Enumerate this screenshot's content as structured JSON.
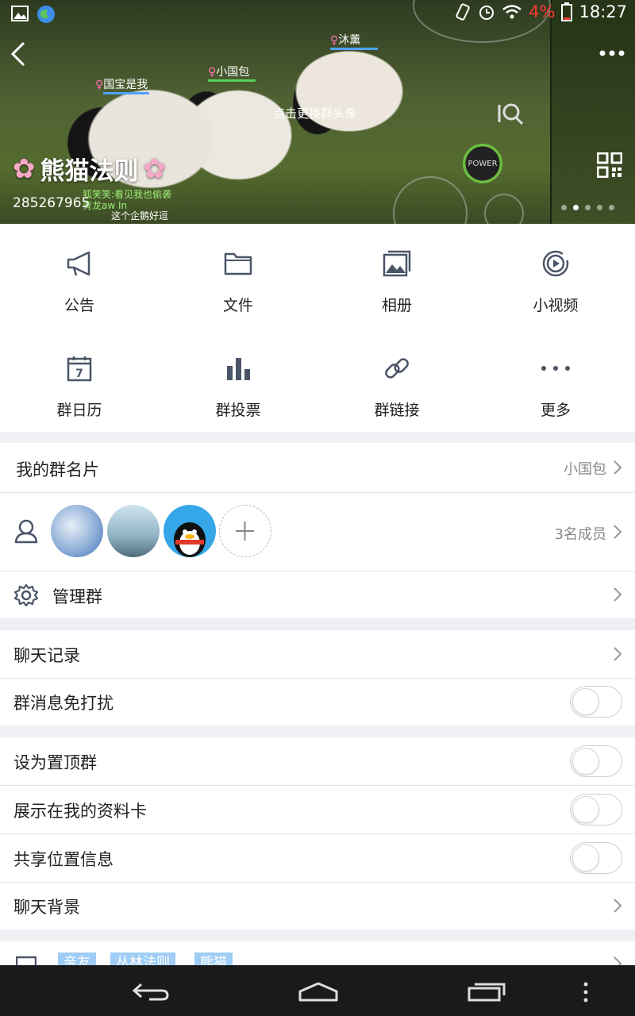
{
  "status_bar": {
    "battery_pct": "4%",
    "time": "18:27"
  },
  "header": {
    "avatar_hint": "点击更换群头像",
    "group_name": "熊猫法则",
    "group_number": "285267965",
    "game_labels": [
      "沐薰",
      "国宝是我",
      "小国包"
    ],
    "chat_lines": [
      "狐笑笑:看见我也偷袭",
      "青龙aw In",
      "这个企鹅好逗"
    ],
    "power_label": "POWER"
  },
  "grid": {
    "items": [
      {
        "label": "公告",
        "icon": "megaphone-icon"
      },
      {
        "label": "文件",
        "icon": "folder-icon"
      },
      {
        "label": "相册",
        "icon": "album-icon"
      },
      {
        "label": "小视频",
        "icon": "video-icon"
      },
      {
        "label": "群日历",
        "icon": "calendar-icon"
      },
      {
        "label": "群投票",
        "icon": "vote-chart-icon"
      },
      {
        "label": "群链接",
        "icon": "link-icon"
      },
      {
        "label": "更多",
        "icon": "more-icon"
      }
    ],
    "calendar_day": "7"
  },
  "card": {
    "label": "我的群名片",
    "value": "小国包"
  },
  "members": {
    "count_label": "3名成员"
  },
  "manage": {
    "label": "管理群"
  },
  "chat_history": {
    "label": "聊天记录"
  },
  "toggles": [
    {
      "label": "群消息免打扰",
      "on": false
    },
    {
      "label": "设为置顶群",
      "on": false
    },
    {
      "label": "展示在我的资料卡",
      "on": false
    },
    {
      "label": "共享位置信息",
      "on": false
    }
  ],
  "background": {
    "label": "聊天背景"
  },
  "tags": [
    "亲友",
    "丛林法则",
    "熊猫"
  ],
  "colors": {
    "accent": "#9fcdf5",
    "battery_low": "#ff3b30"
  }
}
